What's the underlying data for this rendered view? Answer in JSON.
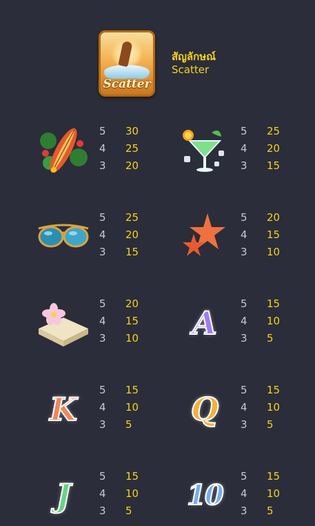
{
  "scatter": {
    "badge_text": "Scatter",
    "title_thai": "สัญลักษณ์",
    "subtitle": "Scatter"
  },
  "paytable": [
    {
      "symbol": "surfboard-icon",
      "counts": [
        "5",
        "4",
        "3"
      ],
      "payouts": [
        "30",
        "25",
        "20"
      ]
    },
    {
      "symbol": "cocktail-icon",
      "counts": [
        "5",
        "4",
        "3"
      ],
      "payouts": [
        "25",
        "20",
        "15"
      ]
    },
    {
      "symbol": "sunglasses-icon",
      "counts": [
        "5",
        "4",
        "3"
      ],
      "payouts": [
        "25",
        "20",
        "15"
      ]
    },
    {
      "symbol": "starfish-icon",
      "counts": [
        "5",
        "4",
        "3"
      ],
      "payouts": [
        "20",
        "15",
        "10"
      ]
    },
    {
      "symbol": "towel-flower-icon",
      "counts": [
        "5",
        "4",
        "3"
      ],
      "payouts": [
        "20",
        "15",
        "10"
      ]
    },
    {
      "symbol": "letter-a",
      "letter": "A",
      "counts": [
        "5",
        "4",
        "3"
      ],
      "payouts": [
        "15",
        "10",
        "5"
      ]
    },
    {
      "symbol": "letter-k",
      "letter": "K",
      "counts": [
        "5",
        "4",
        "3"
      ],
      "payouts": [
        "15",
        "10",
        "5"
      ]
    },
    {
      "symbol": "letter-q",
      "letter": "Q",
      "counts": [
        "5",
        "4",
        "3"
      ],
      "payouts": [
        "15",
        "10",
        "5"
      ]
    },
    {
      "symbol": "letter-j",
      "letter": "J",
      "counts": [
        "5",
        "4",
        "3"
      ],
      "payouts": [
        "15",
        "10",
        "5"
      ]
    },
    {
      "symbol": "number-10",
      "letter": "10",
      "counts": [
        "5",
        "4",
        "3"
      ],
      "payouts": [
        "15",
        "10",
        "5"
      ]
    }
  ],
  "colors": {
    "background": "#2b2d3a",
    "payout": "#f6d21a",
    "count": "#c9cad1"
  }
}
